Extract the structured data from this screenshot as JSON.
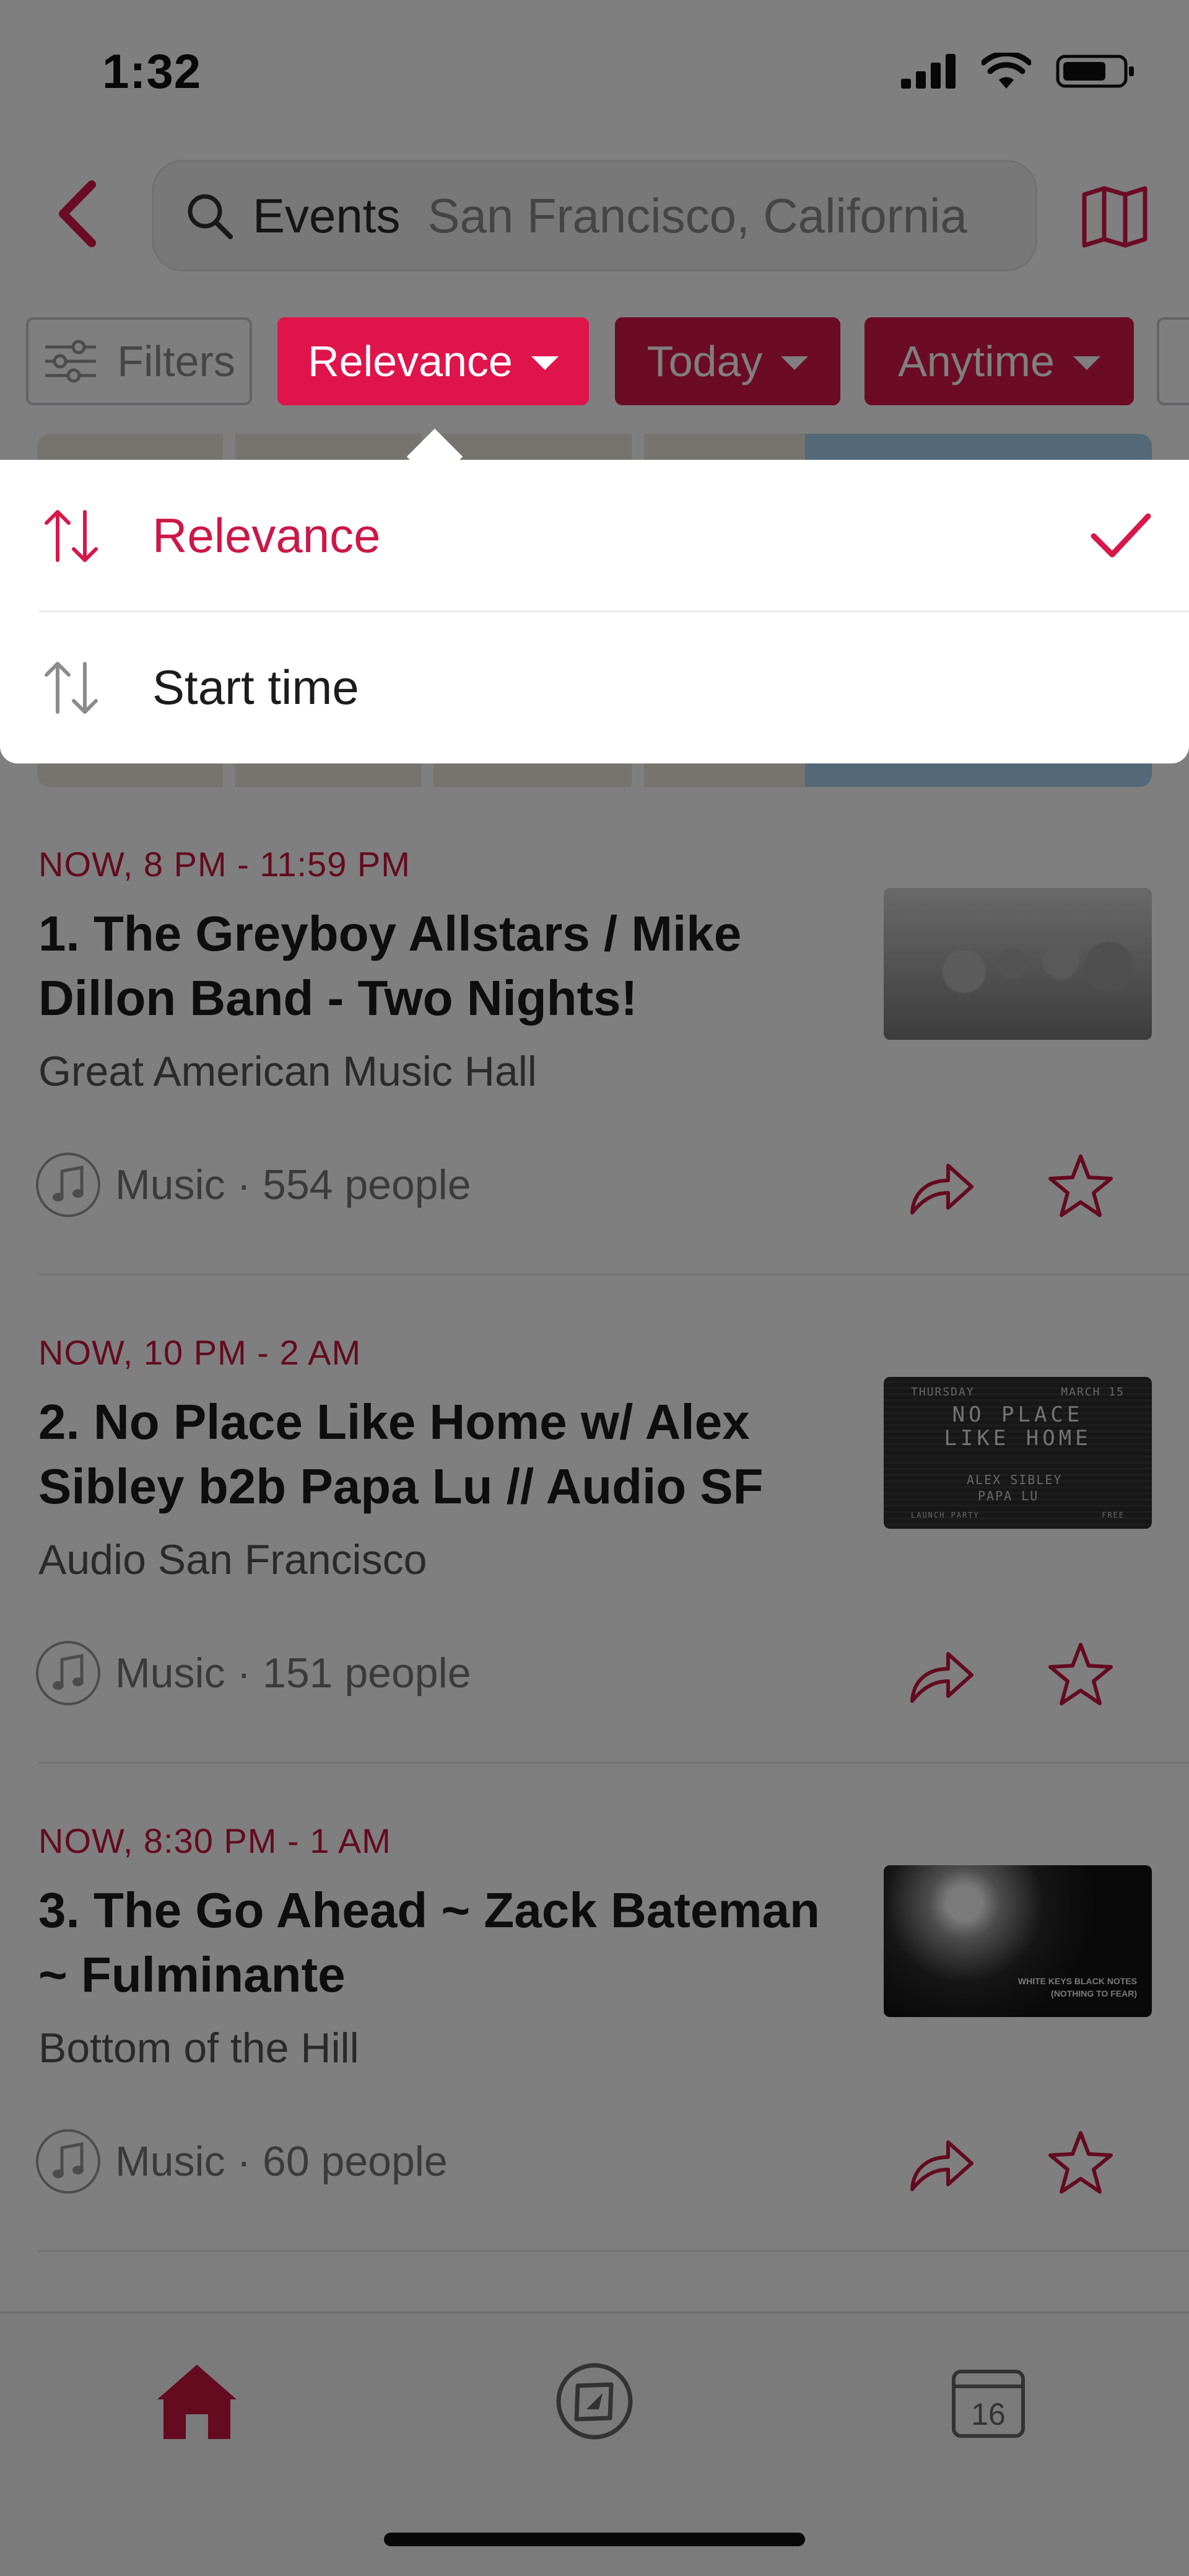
{
  "status_bar": {
    "time": "1:32"
  },
  "header": {
    "search_term": "Events",
    "search_location": "San Francisco, California"
  },
  "filters": {
    "filters_label": "Filters",
    "sort_label": "Relevance",
    "date_label": "Today",
    "time_label": "Anytime"
  },
  "sort_dropdown": {
    "options": [
      {
        "label": "Relevance",
        "selected": true
      },
      {
        "label": "Start time",
        "selected": false
      }
    ]
  },
  "events": [
    {
      "time": "NOW, 8 PM - 11:59 PM",
      "title": "1. The Greyboy Allstars / Mike Dillon Band - Two Nights!",
      "venue": "Great American Music Hall",
      "category": "Music",
      "attendance": "554 people",
      "meta": "Music · 554 people"
    },
    {
      "time": "NOW, 10 PM - 2 AM",
      "title": "2. No Place Like Home w/ Alex Sibley b2b Papa Lu // Audio SF",
      "venue": "Audio San Francisco",
      "category": "Music",
      "attendance": "151 people",
      "meta": "Music · 151 people",
      "thumb_text": {
        "top_left": "THURSDAY",
        "top_right": "MARCH 15",
        "line1": "NO PLACE",
        "line2": "LIKE HOME",
        "artist1": "ALEX SIBLEY",
        "artist2": "PAPA LU",
        "bottom_left": "LAUNCH PARTY",
        "bottom_right": "FREE"
      }
    },
    {
      "time": "NOW, 8:30 PM - 1 AM",
      "title": "3. The Go Ahead ~ Zack Bateman ~ Fulminante",
      "venue": "Bottom of the Hill",
      "category": "Music",
      "attendance": "60 people",
      "meta": "Music · 60 people",
      "thumb_text": {
        "line1": "WHITE KEYS BLACK NOTES",
        "line2": "(NOTHING TO FEAR)"
      }
    }
  ],
  "tabbar": {
    "calendar_day": "16"
  },
  "colors": {
    "accent": "#d8174b",
    "accent_bright": "#e0144c",
    "selected_text": "#cc1748",
    "dim_overlay": "rgba(0,0,0,0.5)"
  },
  "icons": [
    "back-icon",
    "search-icon",
    "map-icon",
    "filters-icon",
    "sort-icon",
    "checkmark-icon",
    "music-note-icon",
    "share-icon",
    "star-icon",
    "home-icon",
    "explore-icon",
    "calendar-icon"
  ]
}
